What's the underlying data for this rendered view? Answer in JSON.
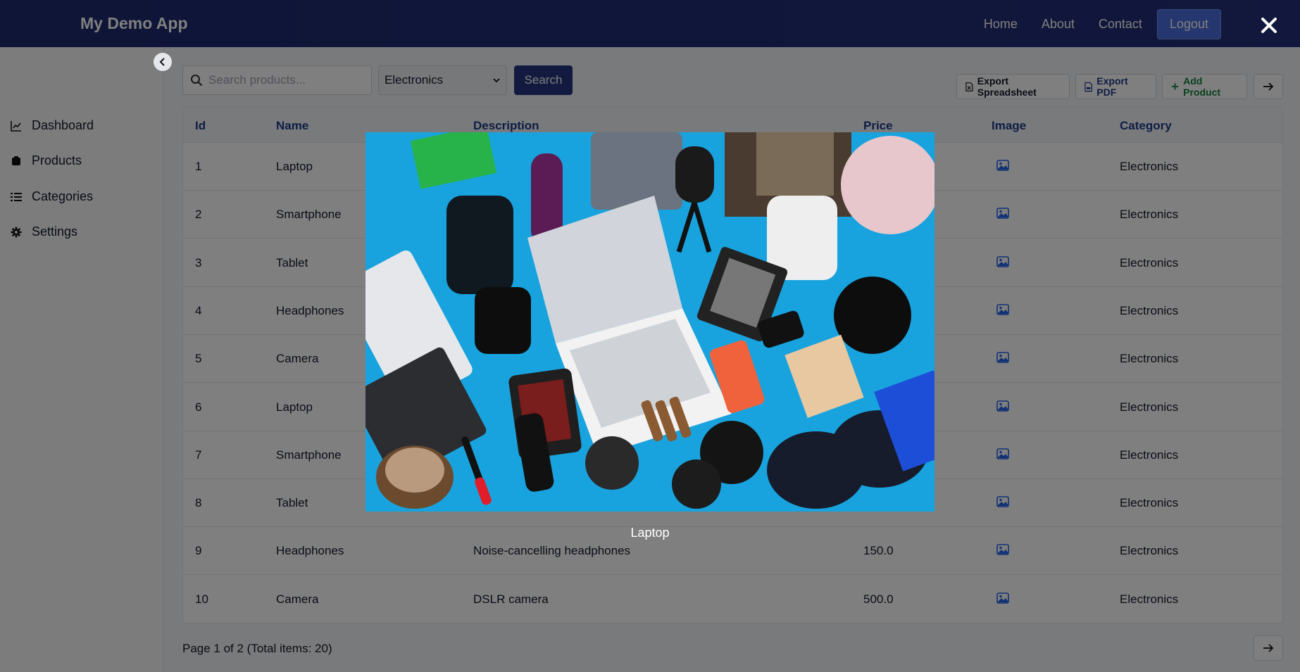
{
  "app": {
    "title": "My Demo App"
  },
  "nav": {
    "home": "Home",
    "about": "About",
    "contact": "Contact",
    "logout": "Logout"
  },
  "sidebar": {
    "items": [
      {
        "label": "Dashboard",
        "icon": "chart-line-icon"
      },
      {
        "label": "Products",
        "icon": "box-icon"
      },
      {
        "label": "Categories",
        "icon": "list-icon"
      },
      {
        "label": "Settings",
        "icon": "gear-icon"
      }
    ]
  },
  "search": {
    "placeholder": "Search products...",
    "value": ""
  },
  "filter": {
    "selected": "Electronics"
  },
  "buttons": {
    "search": "Search",
    "export_spreadsheet": "Export Spreadsheet",
    "export_pdf": "Export PDF",
    "add_product": "Add Product"
  },
  "table": {
    "headers": [
      "Id",
      "Name",
      "Description",
      "Price",
      "Image",
      "Category"
    ],
    "rows": [
      {
        "id": "1",
        "name": "Laptop",
        "description": "",
        "price": "",
        "category": "Electronics"
      },
      {
        "id": "2",
        "name": "Smartphone",
        "description": "",
        "price": "",
        "category": "Electronics"
      },
      {
        "id": "3",
        "name": "Tablet",
        "description": "",
        "price": "",
        "category": "Electronics"
      },
      {
        "id": "4",
        "name": "Headphones",
        "description": "",
        "price": "",
        "category": "Electronics"
      },
      {
        "id": "5",
        "name": "Camera",
        "description": "",
        "price": "",
        "category": "Electronics"
      },
      {
        "id": "6",
        "name": "Laptop",
        "description": "",
        "price": "",
        "category": "Electronics"
      },
      {
        "id": "7",
        "name": "Smartphone",
        "description": "",
        "price": "",
        "category": "Electronics"
      },
      {
        "id": "8",
        "name": "Tablet",
        "description": "",
        "price": "",
        "category": "Electronics"
      },
      {
        "id": "9",
        "name": "Headphones",
        "description": "Noise-cancelling headphones",
        "price": "150.0",
        "category": "Electronics"
      },
      {
        "id": "10",
        "name": "Camera",
        "description": "DSLR camera",
        "price": "500.0",
        "category": "Electronics"
      }
    ]
  },
  "pagination": {
    "text": "Page 1 of 2 (Total items: 20)"
  },
  "modal": {
    "caption": "Laptop"
  },
  "colors": {
    "header": "#1e2a6e",
    "accent": "#26357f",
    "logout": "#4a6fdc",
    "add": "#15803d",
    "overlay": "rgba(0,0,0,0.5)"
  }
}
